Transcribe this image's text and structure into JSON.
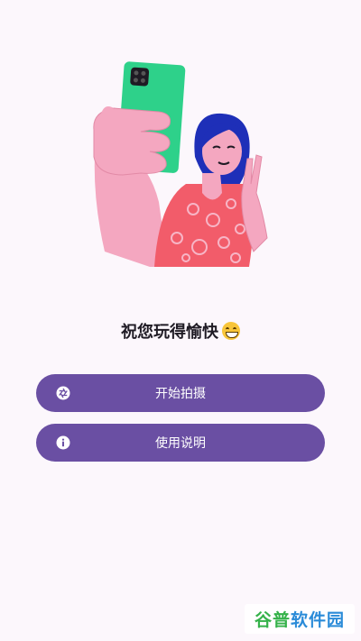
{
  "greeting": {
    "text": "祝您玩得愉快",
    "emoji": "grinning-face-emoji"
  },
  "buttons": {
    "start_label": "开始拍摄",
    "start_icon": "aperture-icon",
    "help_label": "使用说明",
    "help_icon": "info-icon"
  },
  "watermark": {
    "part1": "谷普",
    "part2": "软件园"
  },
  "colors": {
    "background": "#FCF7FC",
    "button": "#6A4FA3",
    "phone": "#2ED18A",
    "skin": "#F4A7C0",
    "shirt": "#F25C6A",
    "hair": "#1E2FB8"
  }
}
